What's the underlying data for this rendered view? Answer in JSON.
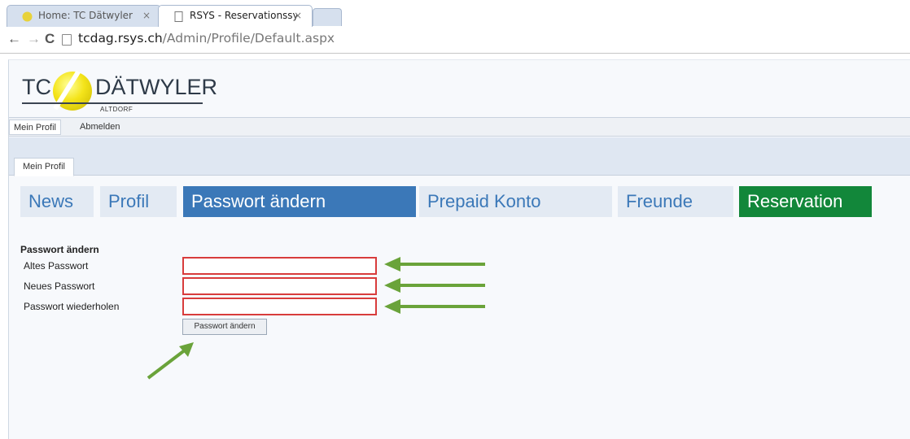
{
  "browser": {
    "tabs": [
      {
        "title": "Home: TC Dätwyler",
        "close": "×"
      },
      {
        "title": "RSYS - Reservationssystem",
        "close": "×"
      }
    ],
    "nav": {
      "back": "←",
      "forward": "→",
      "reload": "C"
    },
    "url": {
      "host": "tcdag.rsys.ch",
      "path": "/Admin/Profile/Default.aspx"
    }
  },
  "logo": {
    "tc": "TC",
    "name": "DÄTWYLER",
    "sub": "ALTDORF"
  },
  "menubar": {
    "items": [
      "Mein Profil",
      "Abmelden"
    ]
  },
  "page_tab": "Mein Profil",
  "main_nav": {
    "items": [
      "News",
      "Profil",
      "Passwort ändern",
      "Prepaid Konto",
      "Freunde",
      "Reservation"
    ],
    "active": "Passwort ändern"
  },
  "form": {
    "title": "Passwort ändern",
    "fields": [
      {
        "label": "Altes Passwort",
        "value": ""
      },
      {
        "label": "Neues Passwort",
        "value": ""
      },
      {
        "label": "Passwort wiederholen",
        "value": ""
      }
    ],
    "submit_label": "Passwort ändern"
  },
  "colors": {
    "nav_active": "#3b78b8",
    "nav_inactive_text": "#3b78b8",
    "reservation": "#12873a",
    "input_highlight": "#d83c3c",
    "annotation_arrow": "#6aa33a"
  }
}
